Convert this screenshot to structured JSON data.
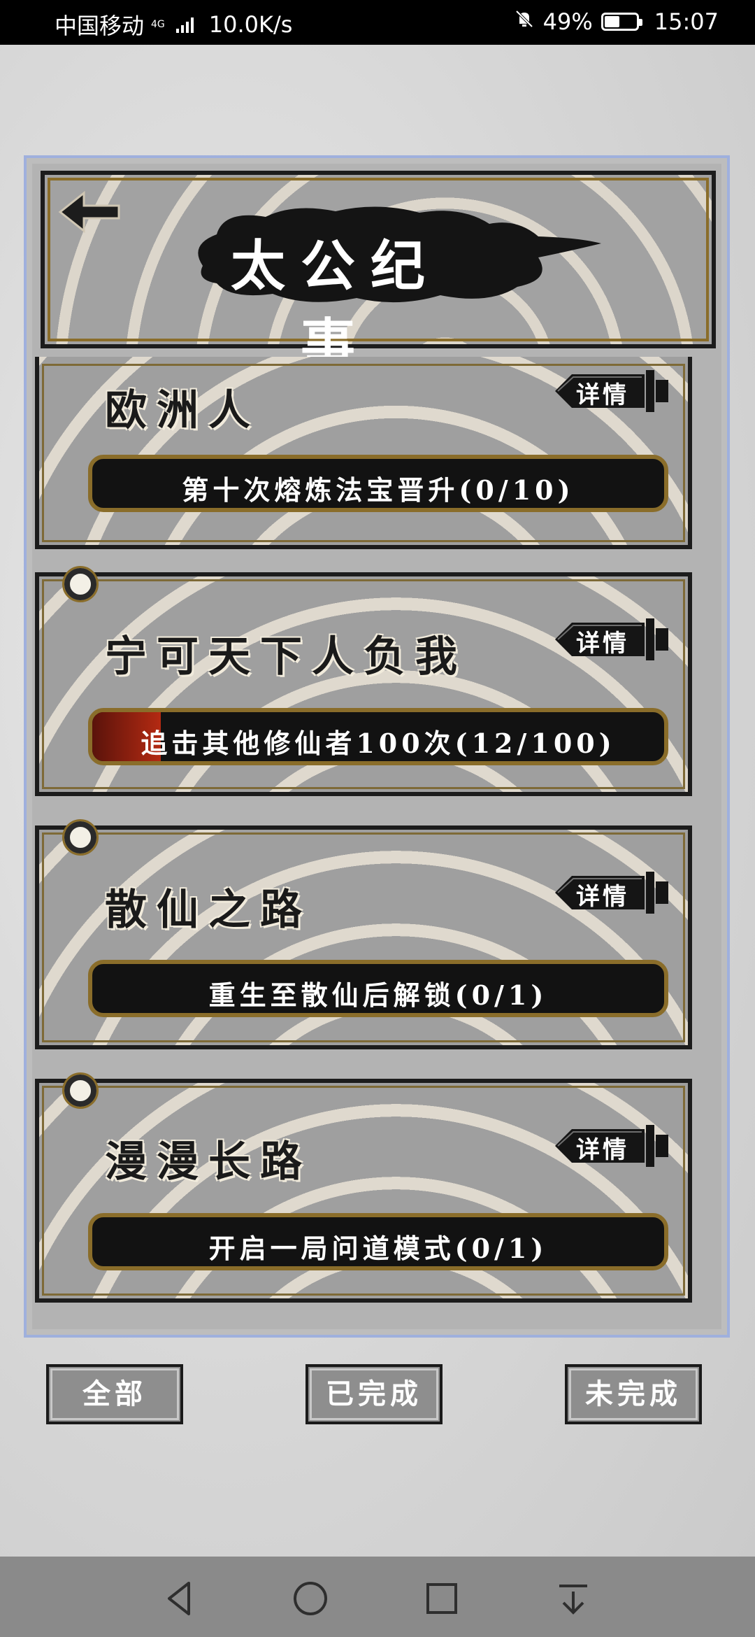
{
  "status_bar": {
    "carrier": "中国移动",
    "network": "4G",
    "speed": "10.0K/s",
    "battery": "49%",
    "battery_level": 0.49,
    "time": "15:07"
  },
  "header": {
    "title": "太公纪事"
  },
  "detail_label": "详情",
  "achievements": [
    {
      "title": "欧洲人",
      "task": "第十次熔炼法宝晋升(0/10)",
      "progress": 0.0
    },
    {
      "title": "宁可天下人负我",
      "task": "追击其他修仙者100次(12/100)",
      "progress": 0.12
    },
    {
      "title": "散仙之路",
      "task": "重生至散仙后解锁(0/1)",
      "progress": 0.0
    },
    {
      "title": "漫漫长路",
      "task": "开启一局问道模式(0/1)",
      "progress": 0.0
    }
  ],
  "filter_tabs": {
    "all": "全部",
    "completed": "已完成",
    "incomplete": "未完成"
  }
}
